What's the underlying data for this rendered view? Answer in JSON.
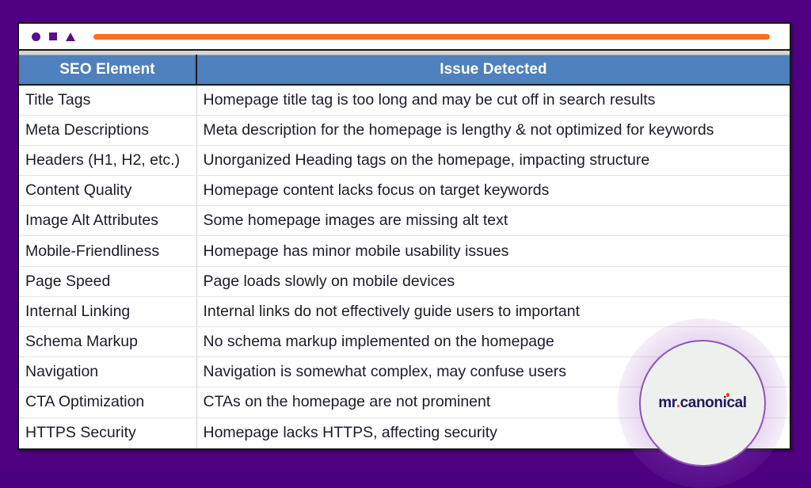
{
  "slide": {
    "background_color": "#4e0080"
  },
  "decor": {
    "shapes": [
      "circle-shape",
      "square-shape",
      "triangle-shape"
    ],
    "shape_color": "#5b0e8b",
    "line_color": "#f4701f"
  },
  "table": {
    "header_background": "#4e81bd",
    "header_text_color": "#ffffff",
    "columns": [
      {
        "key": "element",
        "label": "SEO Element"
      },
      {
        "key": "issue",
        "label": "Issue Detected"
      }
    ],
    "rows": [
      {
        "element": "Title Tags",
        "issue": "Homepage title tag is too long and may be cut off in search results"
      },
      {
        "element": "Meta Descriptions",
        "issue": "Meta description for the homepage is lengthy & not optimized for keywords"
      },
      {
        "element": "Headers (H1, H2, etc.)",
        "issue": "Unorganized Heading tags on the homepage, impacting structure"
      },
      {
        "element": "Content Quality",
        "issue": "Homepage content lacks focus on target keywords"
      },
      {
        "element": "Image Alt Attributes",
        "issue": "Some homepage images are missing alt text"
      },
      {
        "element": "Mobile-Friendliness",
        "issue": "Homepage has minor mobile usability issues"
      },
      {
        "element": "Page Speed",
        "issue": "Page loads slowly on mobile devices"
      },
      {
        "element": "Internal Linking",
        "issue": "Internal links do not effectively guide users to important"
      },
      {
        "element": "Schema Markup",
        "issue": "No schema markup implemented on the homepage"
      },
      {
        "element": "Navigation",
        "issue": "Navigation is somewhat complex, may confuse users"
      },
      {
        "element": "CTA Optimization",
        "issue": "CTAs on the homepage are not prominent"
      },
      {
        "element": "HTTPS Security",
        "issue": "Homepage lacks HTTPS, affecting security"
      }
    ]
  },
  "watermark": {
    "text_part_1": "mr",
    "dot": ".",
    "text_part_2": "canonical",
    "text_color": "#231a5e",
    "accent_color": "#f0430f",
    "ring_color": "#8e55b8"
  }
}
